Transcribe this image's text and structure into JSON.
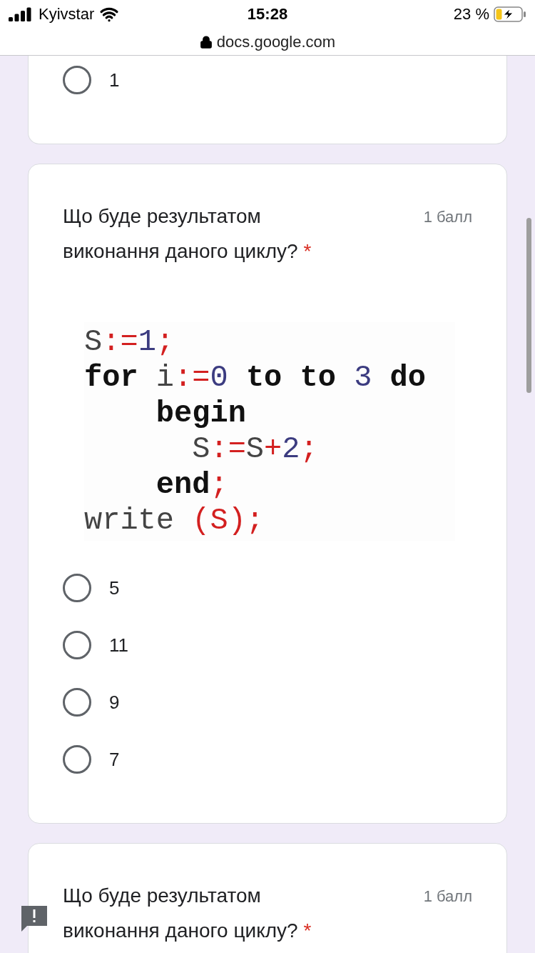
{
  "status_bar": {
    "carrier": "Kyivstar",
    "time": "15:28",
    "battery": "23 %",
    "charging": true
  },
  "address_bar": {
    "url": "docs.google.com"
  },
  "questions": [
    {
      "kind": "options_only",
      "options": [
        {
          "label": "1",
          "selected": false
        }
      ]
    },
    {
      "kind": "full",
      "title": "Що буде результатом виконання даного циклу?",
      "required": true,
      "required_mark": "*",
      "points": "1 балл",
      "code": [
        [
          {
            "text": "S",
            "kind": "id"
          },
          {
            "text": ":=",
            "kind": "op"
          },
          {
            "text": "1",
            "kind": "num"
          },
          {
            "text": ";",
            "kind": "op"
          }
        ],
        [
          {
            "text": "for",
            "kind": "kw"
          },
          {
            "text": " i",
            "kind": "id"
          },
          {
            "text": ":=",
            "kind": "op"
          },
          {
            "text": "0",
            "kind": "num"
          },
          {
            "text": " to",
            "kind": "kw"
          },
          {
            "text": " to",
            "kind": "kw"
          },
          {
            "text": " 3",
            "kind": "num"
          },
          {
            "text": " do",
            "kind": "kw"
          }
        ],
        [
          {
            "text": "    begin",
            "kind": "kw"
          }
        ],
        [
          {
            "text": "      S",
            "kind": "id"
          },
          {
            "text": ":=",
            "kind": "op"
          },
          {
            "text": "S",
            "kind": "id"
          },
          {
            "text": "+",
            "kind": "op"
          },
          {
            "text": "2",
            "kind": "num"
          },
          {
            "text": ";",
            "kind": "op"
          }
        ],
        [
          {
            "text": "    end",
            "kind": "kw"
          },
          {
            "text": ";",
            "kind": "op"
          }
        ],
        [
          {
            "text": "write ",
            "kind": "id"
          },
          {
            "text": "(S);",
            "kind": "op"
          }
        ]
      ],
      "options": [
        {
          "label": "5",
          "selected": false
        },
        {
          "label": "11",
          "selected": false
        },
        {
          "label": "9",
          "selected": false
        },
        {
          "label": "7",
          "selected": false
        }
      ]
    },
    {
      "kind": "header_only",
      "title": "Що буде результатом виконання даного циклу?",
      "required": true,
      "required_mark": "*",
      "points": "1 балл"
    }
  ]
}
